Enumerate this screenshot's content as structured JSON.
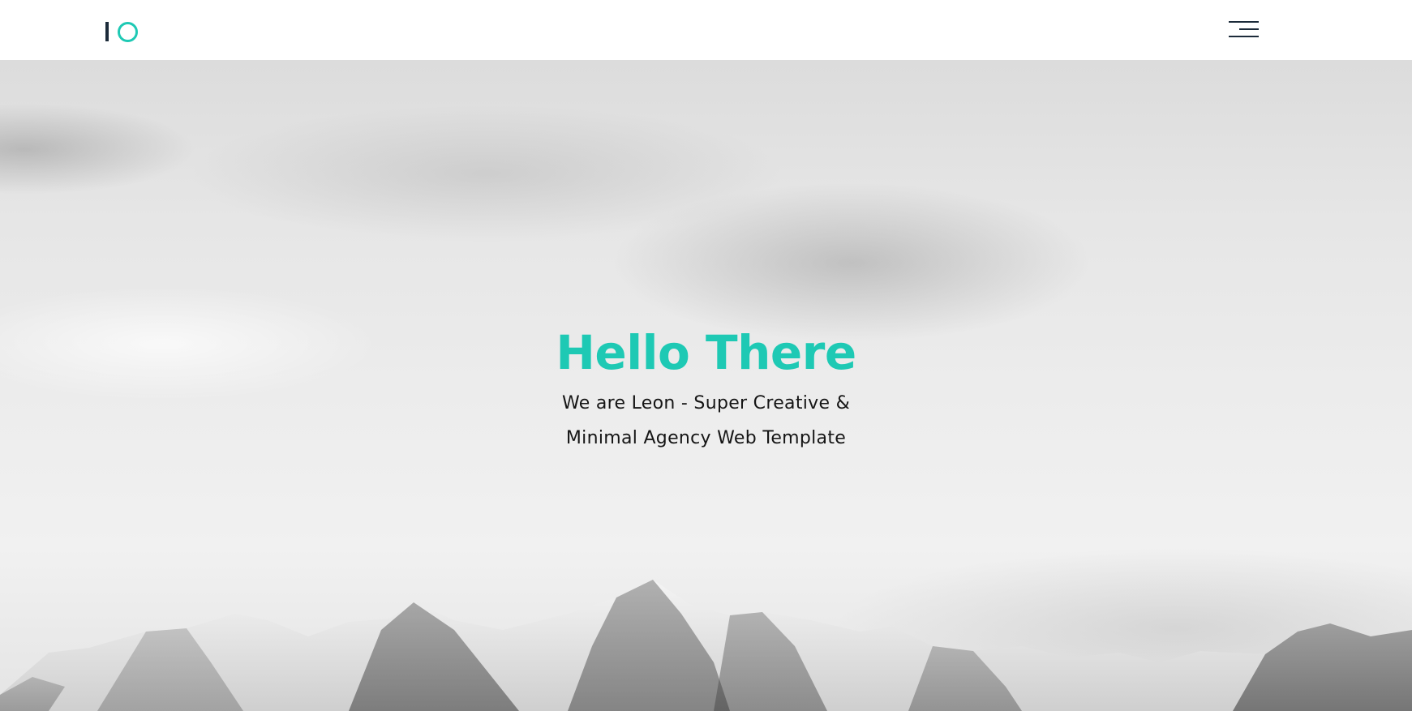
{
  "header": {
    "logo_name": "leon-logo",
    "menu_icon": "hamburger-menu-icon"
  },
  "hero": {
    "title": "Hello There",
    "subtitle": "We are Leon - Super Creative & Minimal Agency Web Template",
    "background": "grayscale-clouds-mountains"
  },
  "colors": {
    "accent": "#1ec9b4",
    "dark": "#1c2b3a",
    "text": "#151515",
    "header_bg": "#ffffff"
  }
}
